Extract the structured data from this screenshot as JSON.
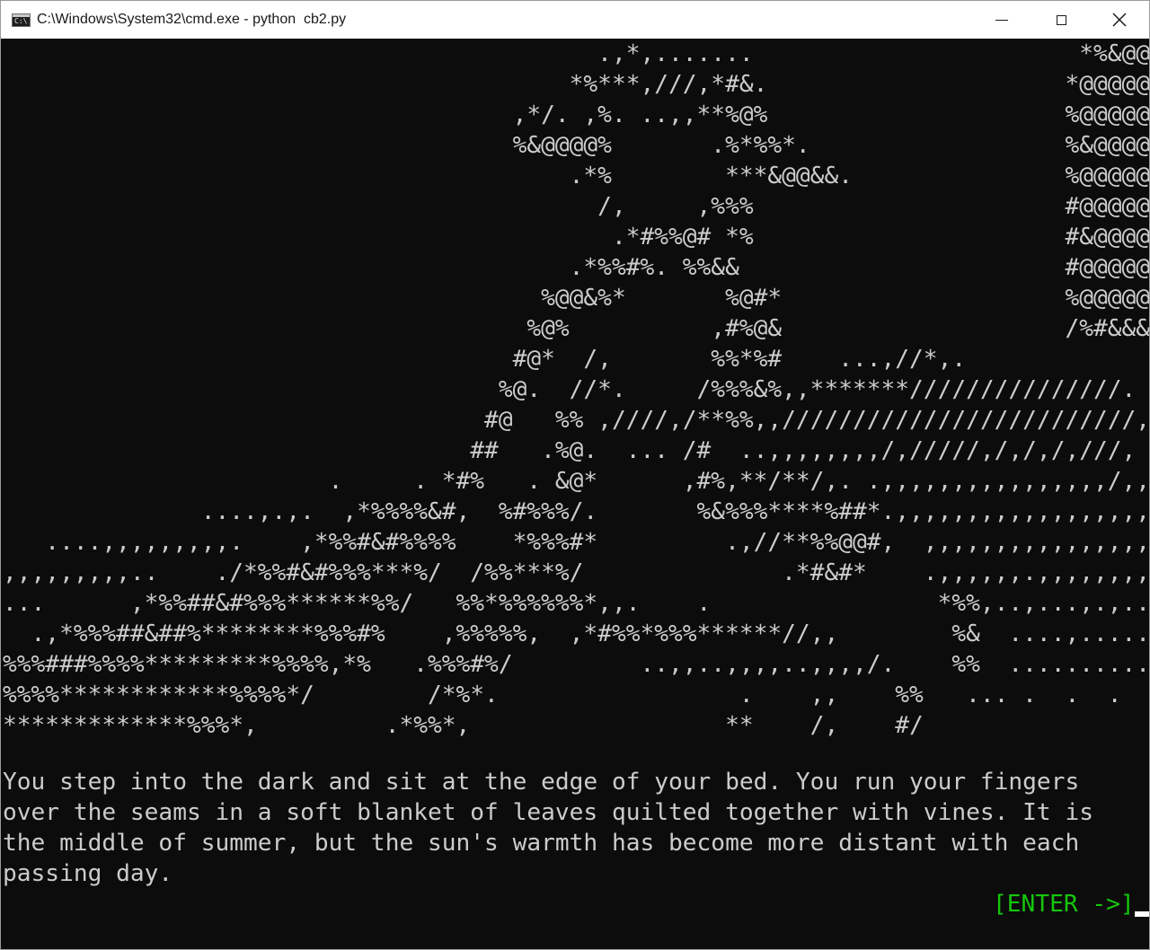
{
  "window": {
    "title": "C:\\Windows\\System32\\cmd.exe - python  cb2.py",
    "icon": "cmd-icon",
    "icon_prompt": "C:\\",
    "controls": [
      "minimize-icon",
      "maximize-icon",
      "close-icon"
    ]
  },
  "console": {
    "background": "#0c0c0c",
    "text_color": "#cccccc",
    "prompt_color": "#16c60c",
    "art_lines": [
      "                                          .,*,.......                       *%&@@&@&@&@@#",
      "                                        *%***,///,*#&.                     *@@@@@@@@@@@@@@",
      "                                    ,*/. ,%. ..,,**%@%                     %@@@@@@@@@@@@@@",
      "                                    %&@@@@%       .%*%%*.                  %&@@@@@@@@@@@@@",
      "                                        .*%        ***&@@&&.               %@@@@@@@@@@@@@@.",
      "                                          /,     ,%%%                      #@@@@@@@@@@@@@@,",
      "                                           .*#%%@# *%                      #&@@@@@@@@@@@@@/",
      "                                        .*%%#%. %%&&                       #@@@@@@@@@@@@@@/",
      "                                      %@@&%*       %@#*                    %@@@@@@@@@@@@@@*",
      "                                     %@%          ,#%@&                    /%#&&&&&&&&#&&@*",
      "                                    #@*  /,       %%*%#    ...,//*,.                      .",
      "                                   %@.  //*.     /%%%&%,,*******///////////////.",
      "                                  #@   %% ,////,/**%%,,/////////////////////////,",
      "                                 ##   .%@.  ... /#  ..,,,,,,,,/,/////,/,/,/,///,",
      "                       .     . *#%   . &@*      ,#%,**/**/,. .,,,,,,,,,,,,,,,,/,,",
      "              ....,.,.  ,*%%%%&#,  %#%%%/.       %&%%%****%##*.,,,,,,,,,,,,,,,,,,",
      "   ....,,,,,,,,,.    ,*%%#&#%%%%    *%%%#*         .,//**%%@@#,  ,,,,,,,,,,,,,,,,",
      ",,,,,,,,,..    ./*%%#&#%%%***%/  /%%***%/              .*#&#*    .,,,,,,.,,,,,,,,",
      "...      ,*%%##&#%%%******%%/   %%*%%%%%%*,,.    .                *%%,..,...,.,....",
      "  .,*%%%##&##%********%%%#%    ,%%%%%,  ,*#%%*%%%******//,,        %&  ....,.......",
      "%%%###%%%%*********%%%%,*%   .%%%#%/         ..,,..,,,,..,,,,/.    %%  ..........",
      "%%%%************%%%%*/        /*%*.                 .    ,,    %%   ... .  .  .  .",
      "*************%%%*,         .*%%*,                  **    /,    #/"
    ],
    "story_lines": [
      "You step into the dark and sit at the edge of your bed. You run your fingers",
      "over the seams in a soft blanket of leaves quilted together with vines. It is",
      "the middle of summer, but the sun's warmth has become more distant with each",
      "passing day."
    ],
    "enter_prompt": "[ENTER ->]"
  }
}
